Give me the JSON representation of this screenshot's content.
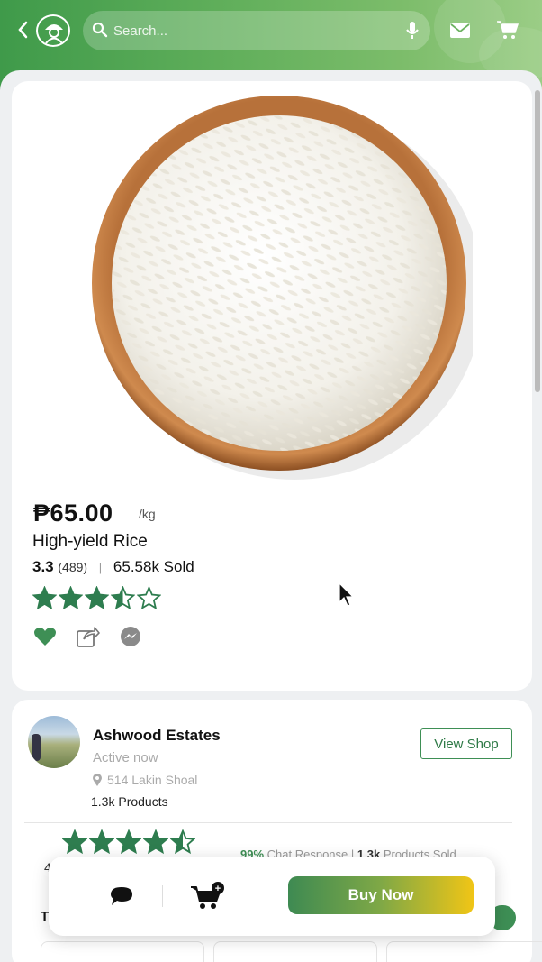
{
  "header": {
    "search_placeholder": "Search..."
  },
  "product": {
    "price": "₱65.00",
    "unit": "/kg",
    "name": "High-yield Rice",
    "rating": "3.3",
    "rating_count": "(489)",
    "separator": "|",
    "sold": "65.58k Sold",
    "stars": 3.5,
    "max_stars": 5
  },
  "shop": {
    "name": "Ashwood Estates",
    "status": "Active now",
    "location": "514 Lakin Shoal",
    "products": "1.3k Products",
    "view_shop_label": "View Shop",
    "rating_prefix": "4",
    "stars": 4.5,
    "chat_response_value": "99%",
    "chat_response_label": "Chat Response",
    "separator": "|",
    "products_sold_value": "1.3k",
    "products_sold_label": "Products Sold",
    "section_initial": "T"
  },
  "bottom_bar": {
    "buy_now_label": "Buy Now",
    "cart_badge": "+"
  },
  "colors": {
    "brand_green": "#3e8f55",
    "star_green": "#2e7d4f",
    "buy_gradient_end": "#f0c516"
  }
}
